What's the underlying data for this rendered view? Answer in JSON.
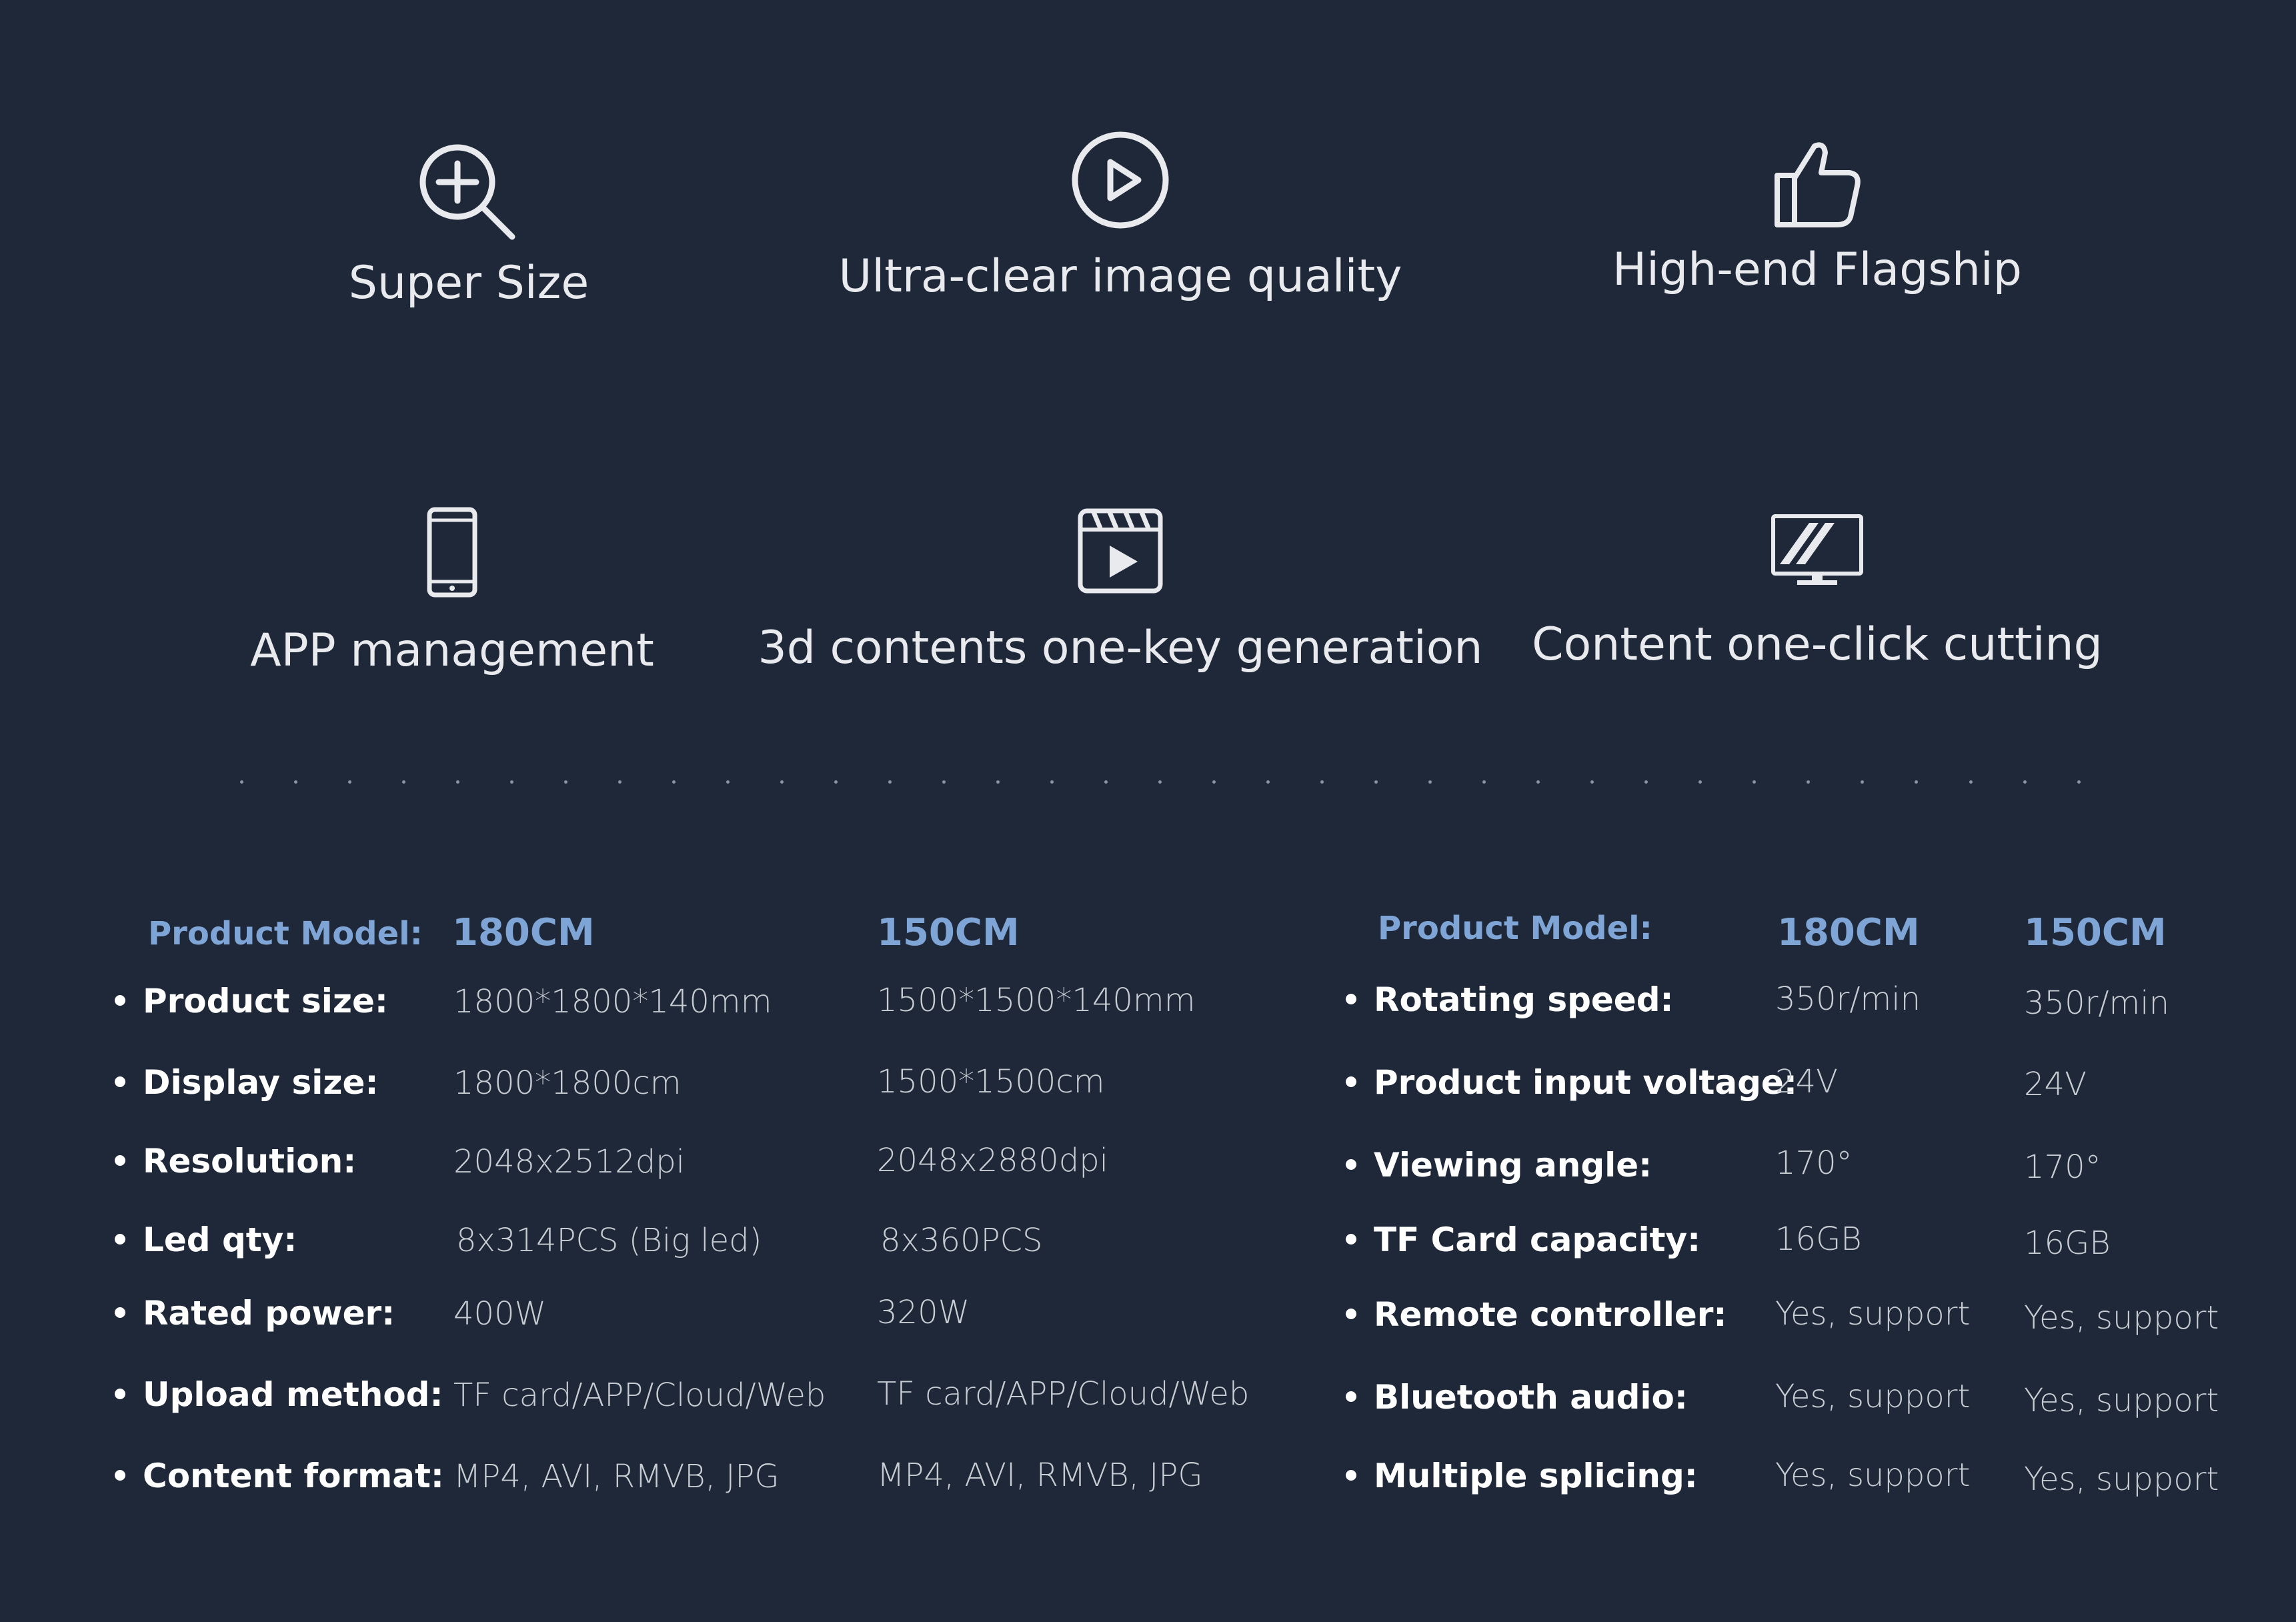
{
  "features": [
    {
      "label": "Super Size",
      "icon": "zoom-in-icon"
    },
    {
      "label": "Ultra-clear image quality",
      "icon": "play-circle-icon"
    },
    {
      "label": "High-end Flagship",
      "icon": "thumbs-up-icon"
    },
    {
      "label": "APP management",
      "icon": "smartphone-icon"
    },
    {
      "label": "3d contents one-key generation",
      "icon": "clapperboard-icon"
    },
    {
      "label": "Content one-click cutting",
      "icon": "monitor-icon"
    }
  ],
  "left_table": {
    "header_label": "Product Model:",
    "models": [
      "180CM",
      "150CM"
    ],
    "rows": [
      {
        "label": "Product size:",
        "v1": "1800*1800*140mm",
        "v2": "1500*1500*140mm"
      },
      {
        "label": "Display size:",
        "v1": "1800*1800cm",
        "v2": "1500*1500cm"
      },
      {
        "label": "Resolution:",
        "v1": "2048x2512dpi",
        "v2": "2048x2880dpi"
      },
      {
        "label": "Led qty:",
        "v1": "8x314PCS (Big led)",
        "v2": "8x360PCS"
      },
      {
        "label": "Rated power:",
        "v1": "400W",
        "v2": "320W"
      },
      {
        "label": "Upload method:",
        "v1": "TF card/APP/Cloud/Web",
        "v2": "TF card/APP/Cloud/Web"
      },
      {
        "label": "Content format:",
        "v1": "MP4, AVI, RMVB, JPG",
        "v2": "MP4, AVI, RMVB, JPG"
      }
    ]
  },
  "right_table": {
    "header_label": "Product Model:",
    "models": [
      "180CM",
      "150CM"
    ],
    "rows": [
      {
        "label": "Rotating speed:",
        "v1": "350r/min",
        "v2": "350r/min"
      },
      {
        "label": "Product input voltage:",
        "v1": "24V",
        "v2": "24V"
      },
      {
        "label": "Viewing angle:",
        "v1": "170°",
        "v2": "170°"
      },
      {
        "label": "TF Card capacity:",
        "v1": "16GB",
        "v2": "16GB"
      },
      {
        "label": "Remote controller:",
        "v1": "Yes, support",
        "v2": "Yes, support"
      },
      {
        "label": "Bluetooth audio:",
        "v1": "Yes, support",
        "v2": "Yes, support"
      },
      {
        "label": "Multiple splicing:",
        "v1": "Yes, support",
        "v2": "Yes, support"
      }
    ]
  }
}
